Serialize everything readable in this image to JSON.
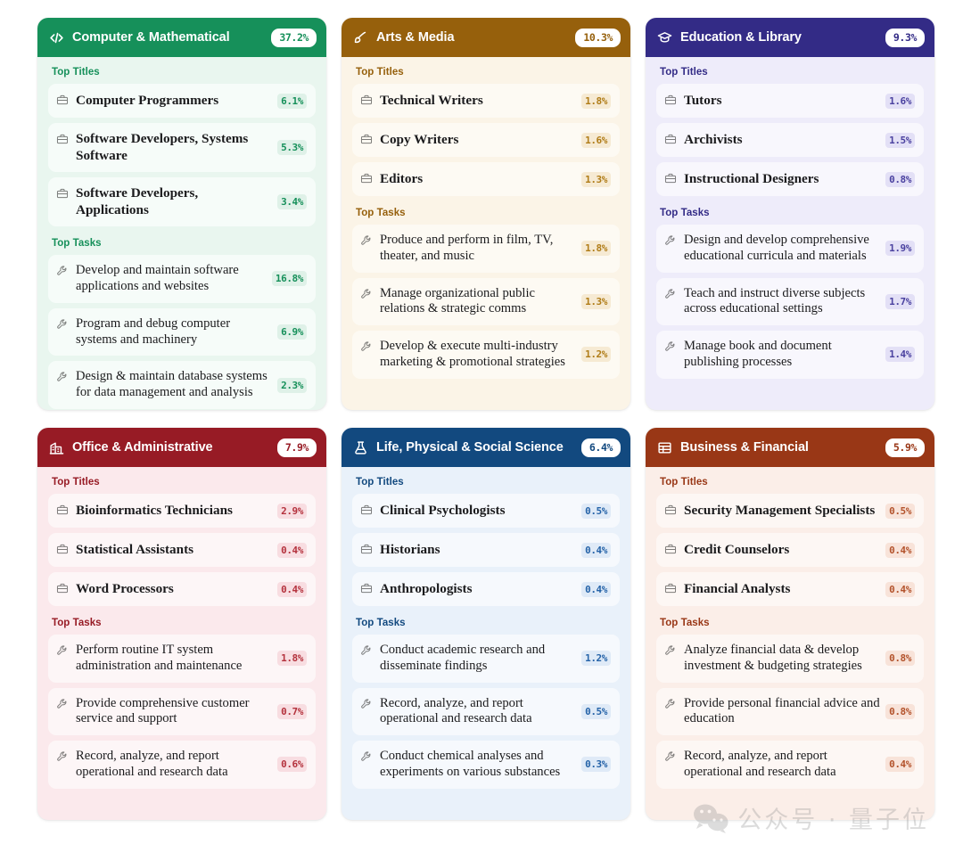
{
  "sections": {
    "titles_label": "Top Titles",
    "tasks_label": "Top Tasks"
  },
  "watermark": {
    "text": "公众号 · 量子位",
    "logo_icon": "wechat-icon"
  },
  "cards": [
    {
      "name": "computer-mathematical",
      "title": "Computer & Mathematical",
      "percent": "37.2%",
      "icon": "code-brackets-icon",
      "header_bg": "#16905a",
      "header_pct_color": "#16905a",
      "body_bg": "#e9f6ef",
      "row_bg": "#f6fcf9",
      "label_color": "#16905a",
      "pct_color": "#16905a",
      "pct_bg": "#dff1e8",
      "titles": [
        {
          "name": "Computer Programmers",
          "percent": "6.1%"
        },
        {
          "name": "Software Developers, Systems Software",
          "percent": "5.3%"
        },
        {
          "name": "Software Developers, Applications",
          "percent": "3.4%"
        }
      ],
      "tasks": [
        {
          "name": "Develop and maintain software applications and websites",
          "percent": "16.8%"
        },
        {
          "name": "Program and debug computer systems and machinery",
          "percent": "6.9%"
        },
        {
          "name": "Design & maintain database systems for data management and analysis",
          "percent": "2.3%"
        }
      ]
    },
    {
      "name": "arts-media",
      "title": "Arts & Media",
      "percent": "10.3%",
      "icon": "paintbrush-icon",
      "header_bg": "#96600c",
      "header_pct_color": "#96600c",
      "body_bg": "#fbf4e7",
      "row_bg": "#fdfaf3",
      "label_color": "#96600c",
      "pct_color": "#b07c17",
      "pct_bg": "#f6ead3",
      "titles": [
        {
          "name": "Technical Writers",
          "percent": "1.8%"
        },
        {
          "name": "Copy Writers",
          "percent": "1.6%"
        },
        {
          "name": "Editors",
          "percent": "1.3%"
        }
      ],
      "tasks": [
        {
          "name": "Produce and perform in film, TV, theater, and music",
          "percent": "1.8%"
        },
        {
          "name": "Manage organizational public relations & strategic comms",
          "percent": "1.3%"
        },
        {
          "name": "Develop & execute multi-industry marketing & promotional strategies",
          "percent": "1.2%"
        }
      ]
    },
    {
      "name": "education-library",
      "title": "Education & Library",
      "percent": "9.3%",
      "icon": "graduation-cap-icon",
      "header_bg": "#332b86",
      "header_pct_color": "#332b86",
      "body_bg": "#eeecfa",
      "row_bg": "#f8f7fd",
      "label_color": "#332b86",
      "pct_color": "#4b42a0",
      "pct_bg": "#e3e0f6",
      "titles": [
        {
          "name": "Tutors",
          "percent": "1.6%"
        },
        {
          "name": "Archivists",
          "percent": "1.5%"
        },
        {
          "name": "Instructional Designers",
          "percent": "0.8%"
        }
      ],
      "tasks": [
        {
          "name": "Design and develop comprehensive educational curricula and materials",
          "percent": "1.9%"
        },
        {
          "name": "Teach and instruct diverse subjects across educational settings",
          "percent": "1.7%"
        },
        {
          "name": "Manage book and document publishing processes",
          "percent": "1.4%"
        }
      ]
    },
    {
      "name": "office-administrative",
      "title": "Office & Administrative",
      "percent": "7.9%",
      "icon": "office-building-icon",
      "header_bg": "#971b25",
      "header_pct_color": "#971b25",
      "body_bg": "#fbe9ec",
      "row_bg": "#fdf6f7",
      "label_color": "#971b25",
      "pct_color": "#b4323d",
      "pct_bg": "#f8dde1",
      "titles": [
        {
          "name": "Bioinformatics Technicians",
          "percent": "2.9%"
        },
        {
          "name": "Statistical Assistants",
          "percent": "0.4%"
        },
        {
          "name": "Word Processors",
          "percent": "0.4%"
        }
      ],
      "tasks": [
        {
          "name": "Perform routine IT system administration and maintenance",
          "percent": "1.8%"
        },
        {
          "name": "Provide comprehensive customer service and support",
          "percent": "0.7%"
        },
        {
          "name": "Record, analyze, and report operational and research data",
          "percent": "0.6%"
        }
      ]
    },
    {
      "name": "life-physical-social-science",
      "title": "Life, Physical & Social Science",
      "percent": "6.4%",
      "icon": "flask-icon",
      "header_bg": "#12497f",
      "header_pct_color": "#12497f",
      "body_bg": "#e9f1fa",
      "row_bg": "#f6f9fd",
      "label_color": "#12497f",
      "pct_color": "#2563a8",
      "pct_bg": "#dfeaf7",
      "titles": [
        {
          "name": "Clinical Psychologists",
          "percent": "0.5%"
        },
        {
          "name": "Historians",
          "percent": "0.4%"
        },
        {
          "name": "Anthropologists",
          "percent": "0.4%"
        }
      ],
      "tasks": [
        {
          "name": "Conduct academic research and disseminate findings",
          "percent": "1.2%"
        },
        {
          "name": "Record, analyze, and report operational and research data",
          "percent": "0.5%"
        },
        {
          "name": "Conduct chemical analyses and experiments on various substances",
          "percent": "0.3%"
        }
      ]
    },
    {
      "name": "business-financial",
      "title": "Business & Financial",
      "percent": "5.9%",
      "icon": "table-grid-icon",
      "header_bg": "#993716",
      "header_pct_color": "#993716",
      "body_bg": "#fbeee8",
      "row_bg": "#fdf7f4",
      "label_color": "#993716",
      "pct_color": "#b3532c",
      "pct_bg": "#f8e3d9",
      "titles": [
        {
          "name": "Security Management Specialists",
          "percent": "0.5%"
        },
        {
          "name": "Credit Counselors",
          "percent": "0.4%"
        },
        {
          "name": "Financial Analysts",
          "percent": "0.4%"
        }
      ],
      "tasks": [
        {
          "name": "Analyze financial data & develop investment & budgeting strategies",
          "percent": "0.8%"
        },
        {
          "name": "Provide personal financial advice and education",
          "percent": "0.8%"
        },
        {
          "name": "Record, analyze, and report operational and research data",
          "percent": "0.4%"
        }
      ]
    }
  ]
}
